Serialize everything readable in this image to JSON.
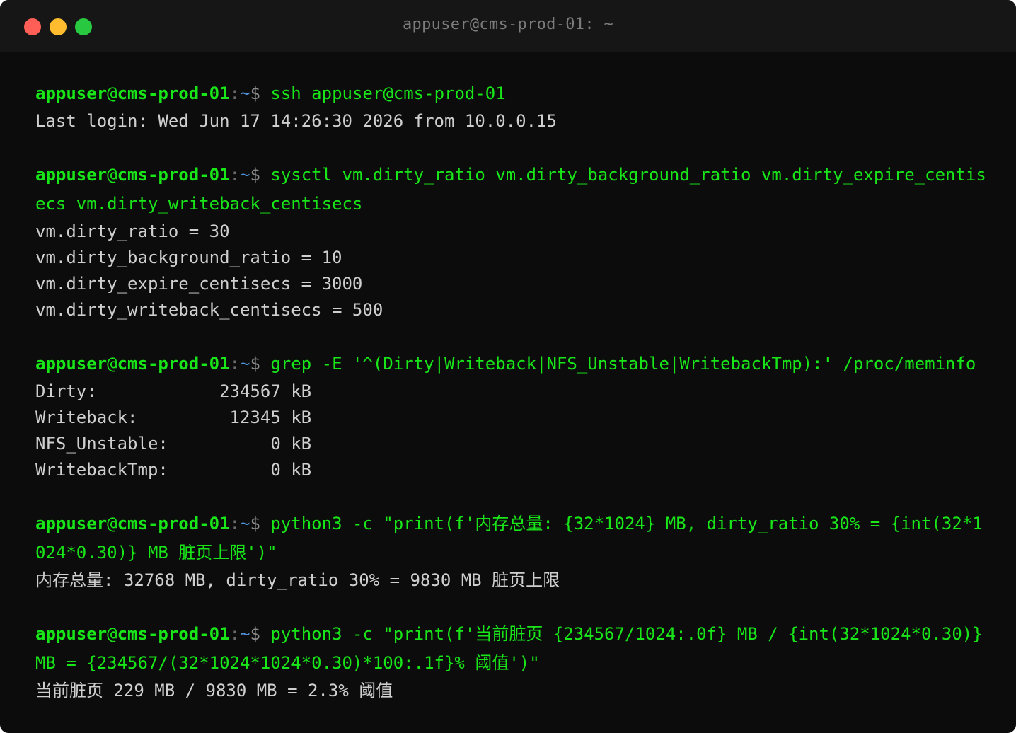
{
  "window": {
    "title": "appuser@cms-prod-01: ~"
  },
  "prompt": {
    "user": "appuser",
    "at": "@",
    "host": "cms-prod-01",
    "sep": ":",
    "path": "~",
    "symbol": "$ "
  },
  "session": [
    {
      "command": "ssh appuser@cms-prod-01",
      "output": [
        "Last login: Wed Jun 17 14:26:30 2026 from 10.0.0.15"
      ]
    },
    {
      "command": "sysctl vm.dirty_ratio vm.dirty_background_ratio vm.dirty_expire_centisecs vm.dirty_writeback_centisecs",
      "output": [
        "vm.dirty_ratio = 30",
        "vm.dirty_background_ratio = 10",
        "vm.dirty_expire_centisecs = 3000",
        "vm.dirty_writeback_centisecs = 500"
      ]
    },
    {
      "command": "grep -E '^(Dirty|Writeback|NFS_Unstable|WritebackTmp):' /proc/meminfo",
      "output": [
        "Dirty:            234567 kB",
        "Writeback:         12345 kB",
        "NFS_Unstable:          0 kB",
        "WritebackTmp:          0 kB"
      ]
    },
    {
      "command": "python3 -c \"print(f'内存总量: {32*1024} MB, dirty_ratio 30% = {int(32*1024*0.30)} MB 脏页上限')\"",
      "output": [
        "内存总量: 32768 MB, dirty_ratio 30% = 9830 MB 脏页上限"
      ]
    },
    {
      "command": "python3 -c \"print(f'当前脏页 {234567/1024:.0f} MB / {int(32*1024*0.30)} MB = {234567/(32*1024*1024*0.30)*100:.1f}% 阈值')\"",
      "output": [
        "当前脏页 229 MB / 9830 MB = 2.3% 阈值"
      ]
    }
  ],
  "colors": {
    "background": "#0c0c0c",
    "titlebar": "#161616",
    "prompt_green": "#19e619",
    "path_blue": "#4f8fd8",
    "output_text": "#cfcfcf"
  }
}
